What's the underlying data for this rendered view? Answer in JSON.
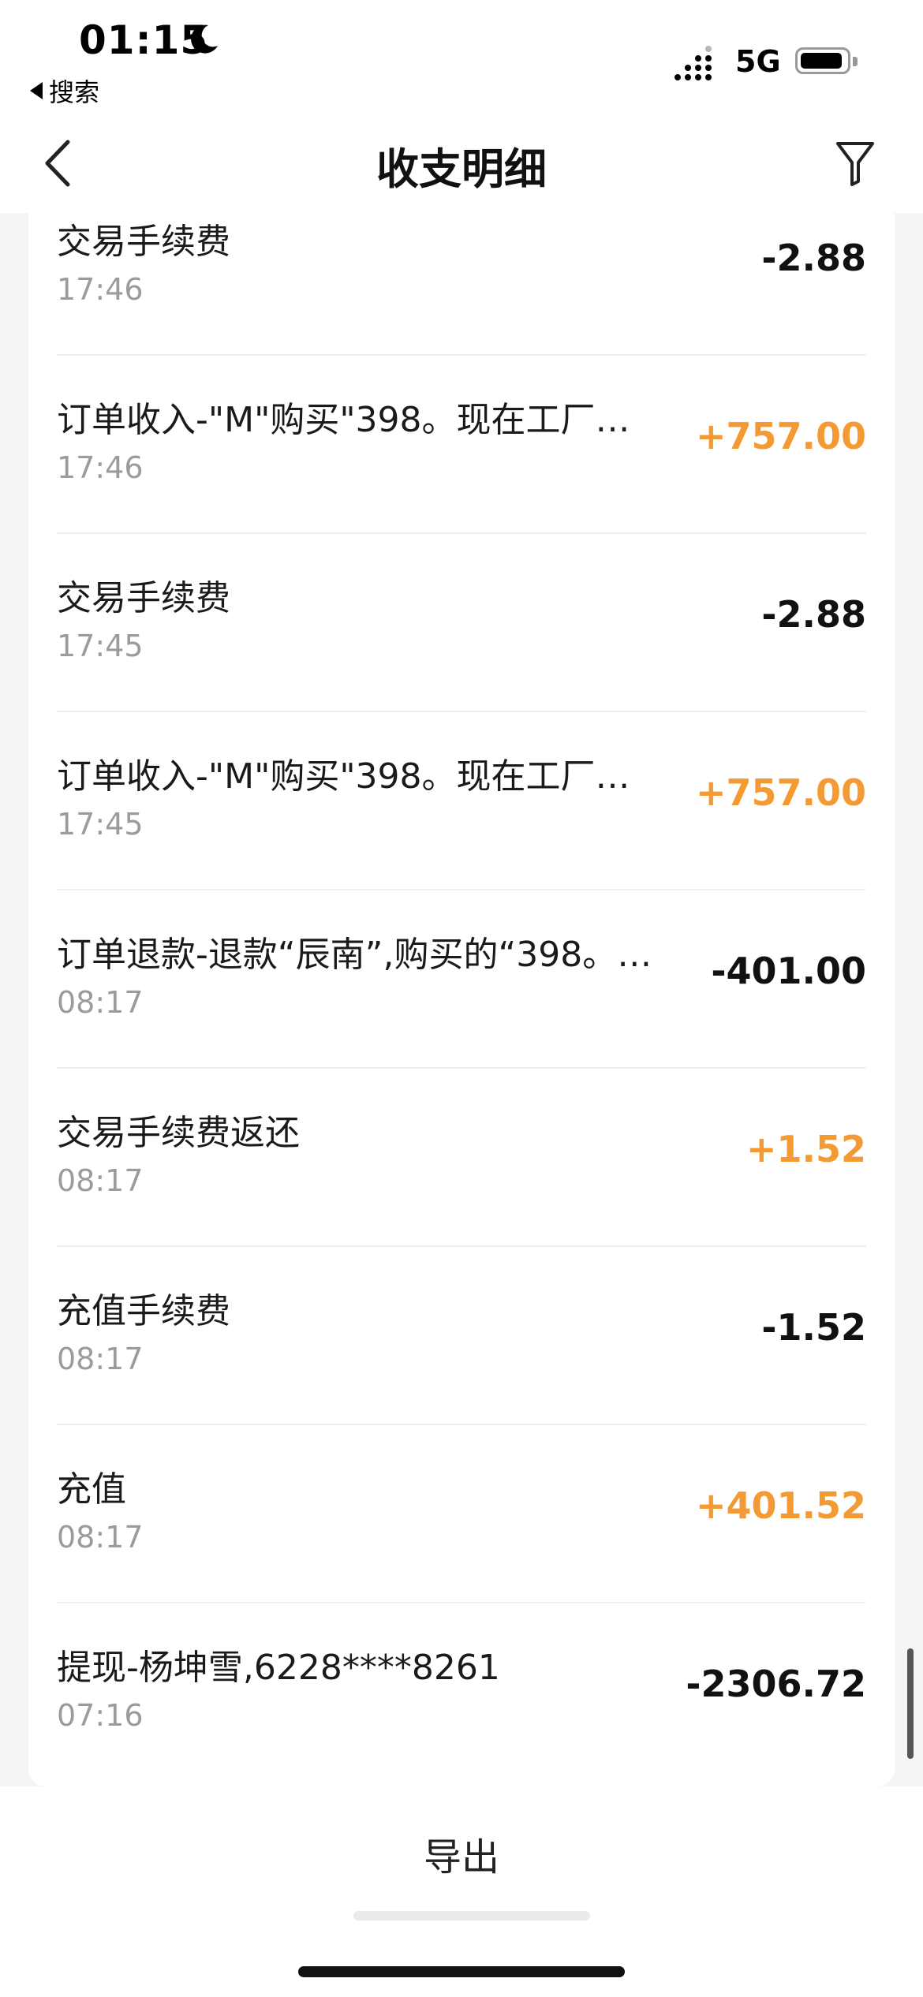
{
  "status_bar": {
    "time": "01:15",
    "back_app": "搜索",
    "network": "5G"
  },
  "nav": {
    "title": "收支明细"
  },
  "transactions": [
    {
      "title": "交易手续费",
      "time": "17:46",
      "amount": "-2.88",
      "positive": false
    },
    {
      "title": "订单收入-\"M\"购买\"398。现在工厂…",
      "time": "17:46",
      "amount": "+757.00",
      "positive": true
    },
    {
      "title": "交易手续费",
      "time": "17:45",
      "amount": "-2.88",
      "positive": false
    },
    {
      "title": "订单收入-\"M\"购买\"398。现在工厂…",
      "time": "17:45",
      "amount": "+757.00",
      "positive": true
    },
    {
      "title": "订单退款-退款“辰南”,购买的“398。…",
      "time": "08:17",
      "amount": "-401.00",
      "positive": false
    },
    {
      "title": "交易手续费返还",
      "time": "08:17",
      "amount": "+1.52",
      "positive": true
    },
    {
      "title": "充值手续费",
      "time": "08:17",
      "amount": "-1.52",
      "positive": false
    },
    {
      "title": "充值",
      "time": "08:17",
      "amount": "+401.52",
      "positive": true
    },
    {
      "title": "提现-杨坤雪,6228****8261",
      "time": "07:16",
      "amount": "-2306.72",
      "positive": false
    }
  ],
  "footer": {
    "export_label": "导出"
  },
  "colors": {
    "positive": "#f39a35",
    "negative": "#111111"
  }
}
